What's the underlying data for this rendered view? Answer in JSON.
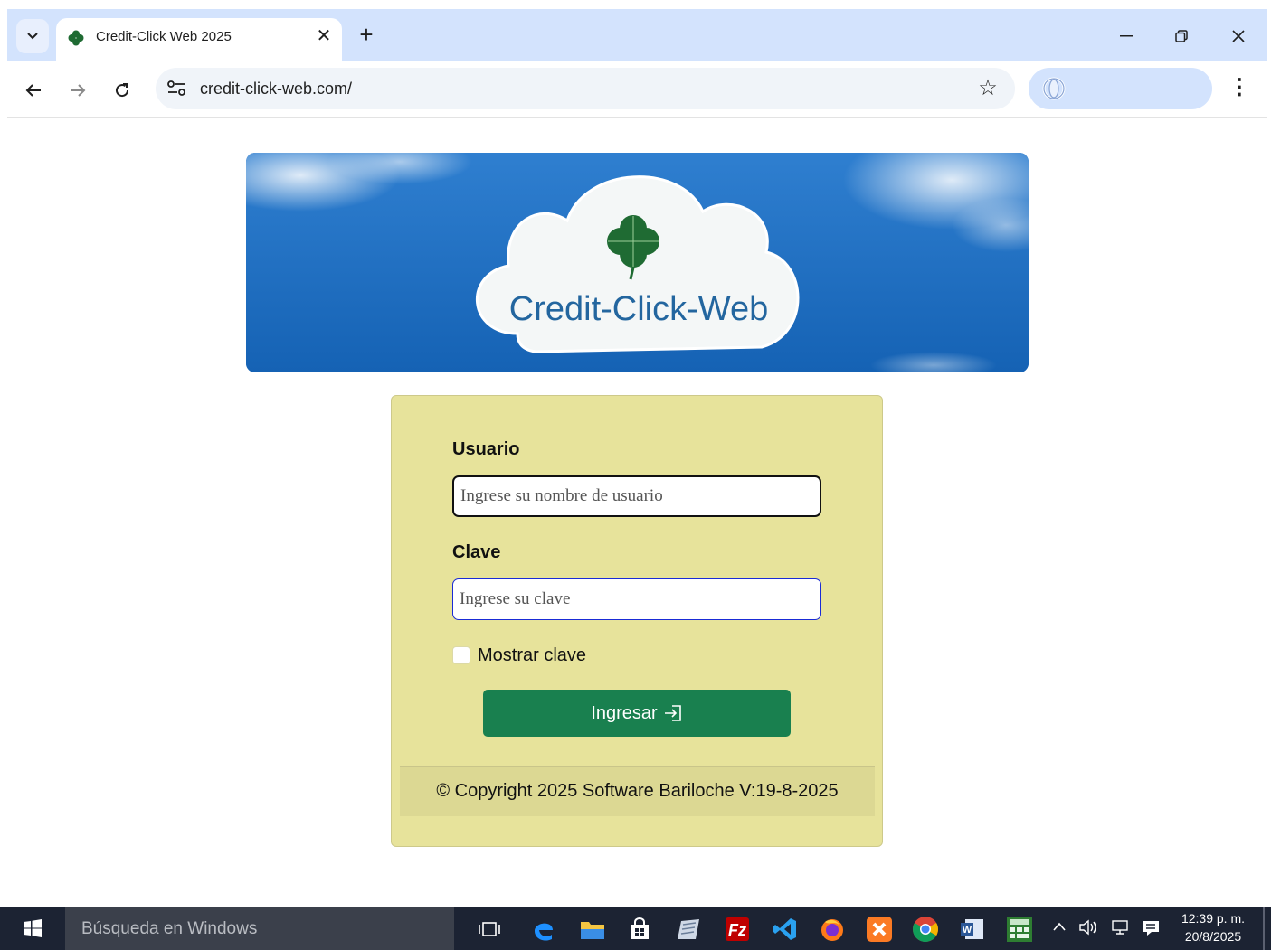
{
  "browser": {
    "tab": {
      "title": "Credit-Click Web 2025",
      "close": "✕"
    },
    "new_tab": "+",
    "url": "credit-click-web.com/",
    "window_controls": {
      "minimize": "—",
      "restore": "❐",
      "close": "✕"
    },
    "nav": {
      "back": "←",
      "forward": "→",
      "reload": "C"
    },
    "menu": "⋮",
    "bookmark": "☆"
  },
  "banner": {
    "brand_text": "Credit-Click-Web"
  },
  "login": {
    "user_label": "Usuario",
    "user_placeholder": "Ingrese su nombre de usuario",
    "user_value": "",
    "password_label": "Clave",
    "password_placeholder": "Ingrese su clave",
    "password_value": "",
    "show_password_label": "Mostrar clave",
    "show_password_checked": false,
    "submit_label": "Ingresar",
    "footer": "© Copyright 2025 Software Bariloche V:19-8-2025"
  },
  "taskbar": {
    "search_placeholder": "Búsqueda en Windows",
    "clock_time": "12:39 p. m.",
    "clock_date": "20/8/2025",
    "tray_chevron": "^",
    "volume": "🔈"
  },
  "colors": {
    "card_bg": "#e7e39b",
    "button_green": "#19804f",
    "banner_blue": "#1a6bc0",
    "clover_green": "#1f6b33",
    "tabstrip": "#d3e3fd",
    "taskbar": "#1c2333"
  }
}
